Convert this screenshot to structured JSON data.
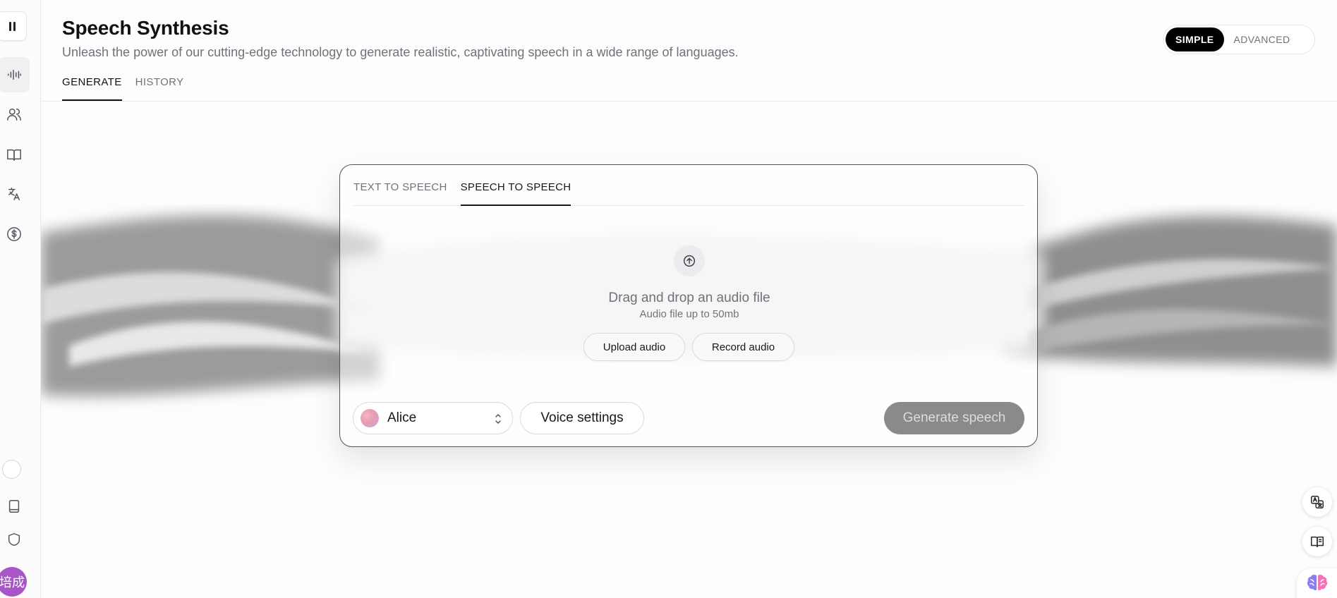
{
  "header": {
    "title": "Speech Synthesis",
    "subtitle": "Unleash the power of our cutting-edge technology to generate realistic, captivating speech in a wide range of languages."
  },
  "top_tabs": [
    {
      "label": "GENERATE",
      "active": true
    },
    {
      "label": "HISTORY",
      "active": false
    }
  ],
  "mode_toggle": {
    "options": [
      "SIMPLE",
      "ADVANCED"
    ],
    "selected": "SIMPLE"
  },
  "sidebar": {
    "items": [
      {
        "icon": "waveform-icon",
        "active": true
      },
      {
        "icon": "users-icon",
        "active": false
      },
      {
        "icon": "book-icon",
        "active": false
      },
      {
        "icon": "translate-icon",
        "active": false
      },
      {
        "icon": "dollar-icon",
        "active": false
      }
    ],
    "bottom_items": [
      "status-circle",
      "tablet-icon",
      "shield-icon"
    ],
    "avatar_text": "培成"
  },
  "card": {
    "tabs": [
      {
        "label": "TEXT TO SPEECH",
        "active": false
      },
      {
        "label": "SPEECH TO SPEECH",
        "active": true
      }
    ],
    "dropzone": {
      "icon": "upload-icon",
      "title": "Drag and drop an audio file",
      "subtitle": "Audio file up to 50mb",
      "upload_label": "Upload audio",
      "record_label": "Record audio"
    },
    "voice": {
      "name": "Alice"
    },
    "voice_settings_label": "Voice settings",
    "generate_label": "Generate speech"
  },
  "floating": [
    "translate-page-icon",
    "reader-icon",
    "brain-icon"
  ],
  "colors": {
    "accent": "#000000",
    "avatar": "#a855c7",
    "generate_disabled": "#8a8a8a"
  }
}
